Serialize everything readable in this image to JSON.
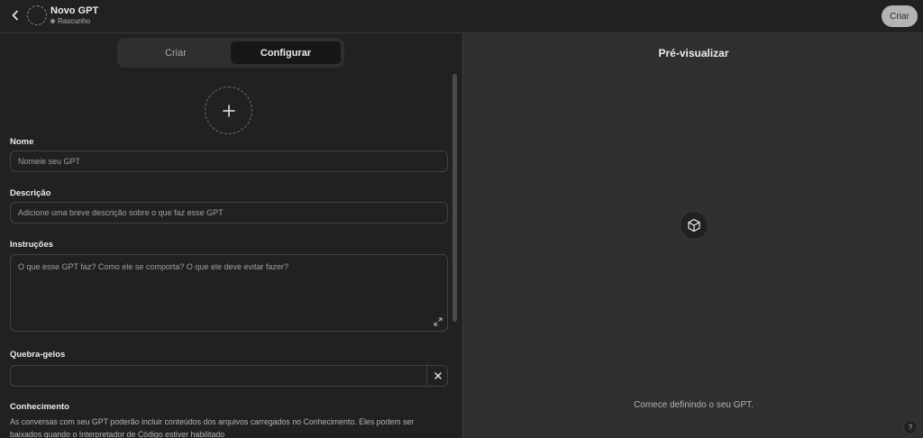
{
  "header": {
    "title": "Novo GPT",
    "status": "Rascunho",
    "create_label": "Criar"
  },
  "tabs": [
    {
      "label": "Criar",
      "active": false
    },
    {
      "label": "Configurar",
      "active": true
    }
  ],
  "form": {
    "name": {
      "label": "Nome",
      "placeholder": "Nomeie seu GPT"
    },
    "description": {
      "label": "Descrição",
      "placeholder": "Adicione uma breve descrição sobre o que faz esse GPT"
    },
    "instructions": {
      "label": "Instruções",
      "placeholder": "O que esse GPT faz? Como ele se comporta? O que ele deve evitar fazer?"
    },
    "conversation_starters": {
      "label": "Quebra-gelos",
      "value": ""
    },
    "knowledge": {
      "label": "Conhecimento",
      "description": "As conversas com seu GPT poderão incluir conteúdos dos arquivos carregados no Conhecimento. Eles podem ser baixados quando o Interpretador de Código estiver habilitado"
    }
  },
  "preview": {
    "title": "Pré-visualizar",
    "hint": "Comece definindo o seu GPT.",
    "help": "?"
  },
  "icons": {
    "back": "chevron-left-icon",
    "upload": "plus-icon",
    "cube": "cube-icon",
    "clear": "close-icon",
    "resize": "expand-icon"
  },
  "colors": {
    "background": "#212121",
    "preview_background": "#2f2f2f",
    "create_button": "#b4b4b4"
  }
}
